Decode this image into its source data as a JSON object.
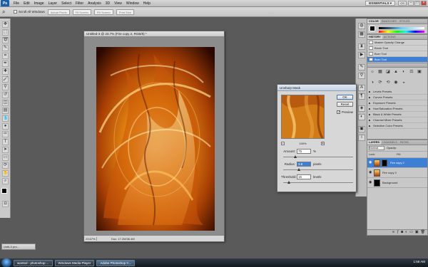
{
  "menubar": {
    "logo": "Ps",
    "items": [
      "File",
      "Edit",
      "Image",
      "Layer",
      "Select",
      "Filter",
      "Analysis",
      "3D",
      "View",
      "Window",
      "Help"
    ],
    "workspace": "ESSENTIALS ▾",
    "cs_live": "CS Live"
  },
  "optbar": {
    "scroll_all_label": "Scroll All Windows",
    "buttons": [
      "Actual Pixels",
      "Fit Screen",
      "Fill Screen",
      "Print Size"
    ]
  },
  "document": {
    "title": "Untitled-3 @ 23.7% (Fire copy 2, RGB/8) *",
    "zoom": "23.67%",
    "doc_info": "Doc: 17.2M/36.4M"
  },
  "unsharp": {
    "title": "Unsharp Mask",
    "ok": "OK",
    "reset": "Reset",
    "preview": "Preview",
    "preview_checked": true,
    "zoom_value": "100%",
    "amount_label": "Amount:",
    "amount_value": "75",
    "amount_unit": "%",
    "amount_pct": 0.15,
    "radius_label": "Radius:",
    "radius_value": "3.8",
    "radius_unit": "pixels",
    "radius_pct": 0.2,
    "threshold_label": "Threshold:",
    "threshold_value": "15",
    "threshold_unit": "levels",
    "threshold_pct": 0.06
  },
  "color_panel": {
    "tabs": [
      "COLOR",
      "SWATCHES",
      "STYLES"
    ]
  },
  "history_panel": {
    "tabs": [
      "HISTORY",
      "ACTIONS"
    ],
    "items": [
      "Master Opacity Change",
      "Brush Tool",
      "Burn Tool",
      "Burn Tool"
    ],
    "selected_index": 3
  },
  "adjustments_panel": {
    "presets": [
      "Levels Presets",
      "Curves Presets",
      "Exposure Presets",
      "Hue/Saturation Presets",
      "Black & White Presets",
      "Channel Mixer Presets",
      "Selective Color Presets"
    ]
  },
  "layers_panel": {
    "tabs": [
      "LAYERS",
      "CHANNELS",
      "PATHS"
    ],
    "mode_label": "Normal",
    "opacity_label": "Opacity:",
    "fill_label": "Fill:",
    "lock_label": "Lock:",
    "layers": [
      "Fire copy 2",
      "Fire copy 3",
      "Background"
    ],
    "active_index": 0
  },
  "taskbar": {
    "tasks": [
      "wanted - photoshop ...",
      "Windows Media Player",
      "Adobe Photoshop C..."
    ],
    "clock": "1:58 AM"
  },
  "minimized_window": "Untit-3 pro...",
  "colors": {
    "accent": "#3c7fd5",
    "fire_dark": "#3a0f00",
    "fire_mid": "#d46a08",
    "fire_light": "#ffd27a"
  },
  "icons": {
    "history_brush": "brush-icon",
    "adjust_icons": [
      "☼",
      "▦",
      "◪",
      "▲",
      "◐",
      "⚖",
      "▣",
      "◑",
      "⟳",
      "⟲",
      "◉",
      "◒"
    ]
  }
}
